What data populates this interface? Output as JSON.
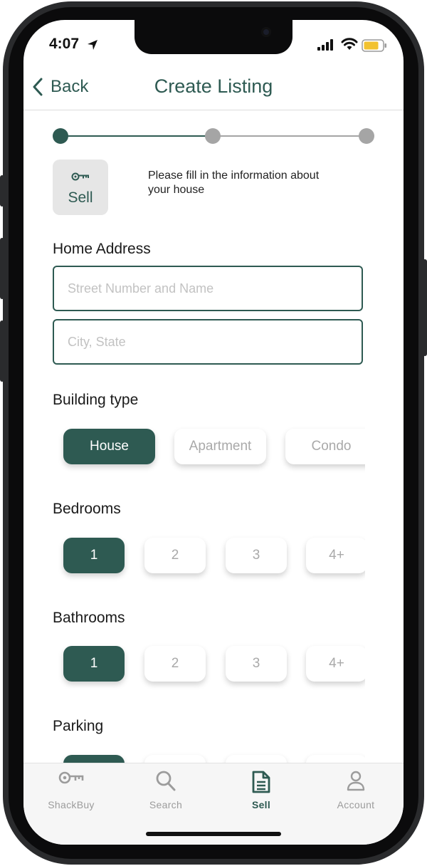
{
  "status_bar": {
    "time": "4:07"
  },
  "header": {
    "back_label": "Back",
    "title": "Create Listing"
  },
  "progress": {
    "steps": 3,
    "current_step": 1
  },
  "intro": {
    "tile_label": "Sell",
    "text": "Please fill in the information about your house"
  },
  "address": {
    "label": "Home Address",
    "street_placeholder": "Street Number and Name",
    "city_placeholder": "City, State"
  },
  "building_type": {
    "label": "Building type",
    "options": [
      "House",
      "Apartment",
      "Condo"
    ],
    "selected": "House"
  },
  "bedrooms": {
    "label": "Bedrooms",
    "options": [
      "1",
      "2",
      "3",
      "4+"
    ],
    "selected": "1"
  },
  "bathrooms": {
    "label": "Bathrooms",
    "options": [
      "1",
      "2",
      "3",
      "4+"
    ],
    "selected": "1"
  },
  "parking": {
    "label": "Parking"
  },
  "tabbar": {
    "items": [
      {
        "label": "ShackBuy",
        "icon": "key-icon"
      },
      {
        "label": "Search",
        "icon": "search-icon"
      },
      {
        "label": "Sell",
        "icon": "document-icon"
      },
      {
        "label": "Account",
        "icon": "person-icon"
      }
    ],
    "active": "Sell"
  },
  "colors": {
    "accent": "#2e5a52",
    "inactive": "#a9a9a9",
    "progress_inactive": "#a5a5a5"
  }
}
